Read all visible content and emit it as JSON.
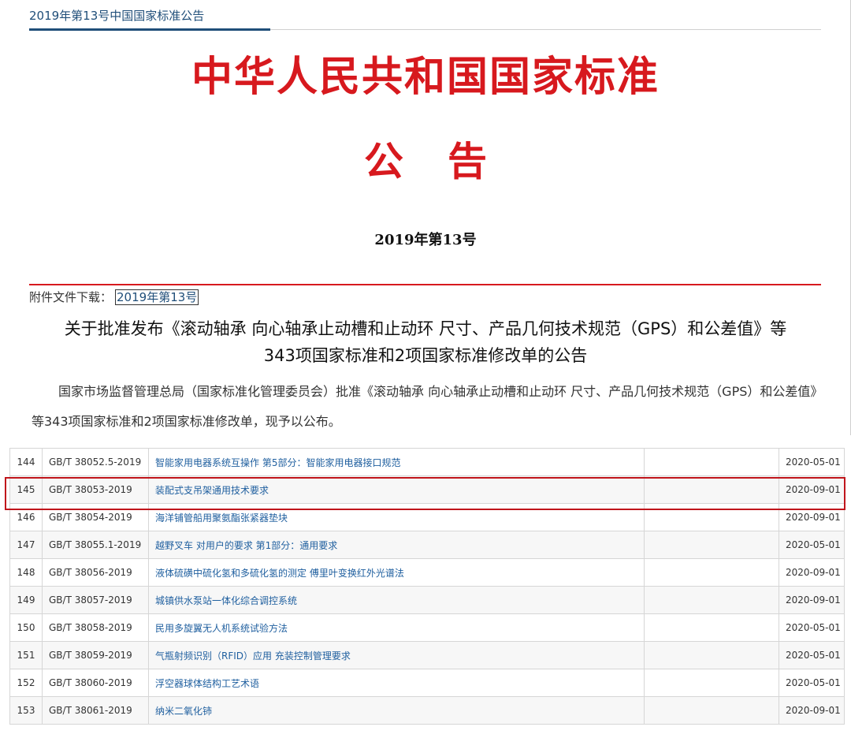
{
  "header": {
    "breadcrumb": "2019年第13号中国国家标准公告"
  },
  "notice": {
    "title": "中华人民共和国国家标准",
    "subtitle": "公告",
    "number": "2019年第13号"
  },
  "attachment": {
    "label": "附件文件下载：",
    "link": "2019年第13号"
  },
  "headline": {
    "line1": "关于批准发布《滚动轴承 向心轴承止动槽和止动环 尺寸、产品几何技术规范（GPS）和公差值》等",
    "line2": "343项国家标准和2项国家标准修改单的公告"
  },
  "body": {
    "paragraph": "国家市场监督管理总局（国家标准化管理委员会）批准《滚动轴承 向心轴承止动槽和止动环 尺寸、产品几何技术规范（GPS）和公差值》等343项国家标准和2项国家标准修改单，现予以公布。"
  },
  "table": {
    "rows": [
      {
        "num": "144",
        "code": "GB/T 38052.5-2019",
        "name": "智能家用电器系统互操作 第5部分：智能家用电器接口规范",
        "date": "2020-05-01"
      },
      {
        "num": "145",
        "code": "GB/T 38053-2019",
        "name": "装配式支吊架通用技术要求",
        "date": "2020-09-01"
      },
      {
        "num": "146",
        "code": "GB/T 38054-2019",
        "name": "海洋铺管船用聚氨酯张紧器垫块",
        "date": "2020-09-01"
      },
      {
        "num": "147",
        "code": "GB/T 38055.1-2019",
        "name": "越野叉车 对用户的要求 第1部分：通用要求",
        "date": "2020-05-01"
      },
      {
        "num": "148",
        "code": "GB/T 38056-2019",
        "name": "液体硫磺中硫化氢和多硫化氢的测定 傅里叶变换红外光谱法",
        "date": "2020-09-01"
      },
      {
        "num": "149",
        "code": "GB/T 38057-2019",
        "name": "城镇供水泵站一体化综合调控系统",
        "date": "2020-09-01"
      },
      {
        "num": "150",
        "code": "GB/T 38058-2019",
        "name": "民用多旋翼无人机系统试验方法",
        "date": "2020-05-01"
      },
      {
        "num": "151",
        "code": "GB/T 38059-2019",
        "name": "气瓶射频识别（RFID）应用 充装控制管理要求",
        "date": "2020-05-01"
      },
      {
        "num": "152",
        "code": "GB/T 38060-2019",
        "name": "浮空器球体结构工艺术语",
        "date": "2020-05-01"
      },
      {
        "num": "153",
        "code": "GB/T 38061-2019",
        "name": "纳米二氧化铈",
        "date": "2020-09-01"
      }
    ]
  },
  "colors": {
    "accent_red": "#d7191e",
    "link_blue": "#1f5f9f",
    "highlight_red": "#c0151b"
  }
}
